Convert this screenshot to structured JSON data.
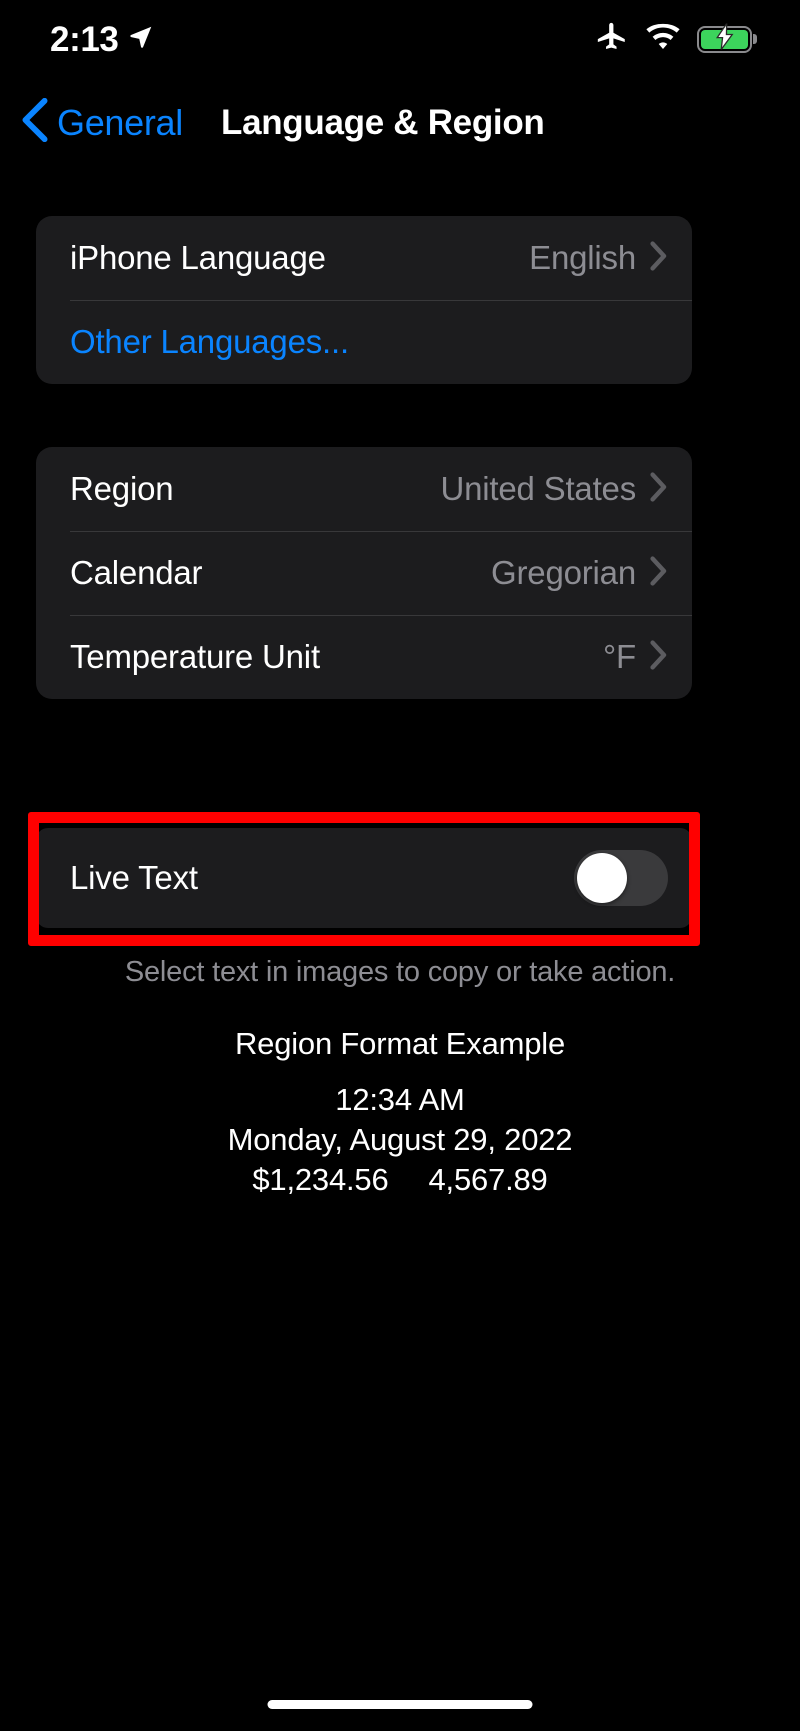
{
  "status_bar": {
    "time": "2:13",
    "location_icon": "location-arrow-icon",
    "airplane_icon": "airplane-mode-icon",
    "wifi_icon": "wifi-icon",
    "battery_icon": "battery-charging-icon",
    "battery_color": "#3cd45c"
  },
  "nav": {
    "back_label": "General",
    "back_icon": "chevron-left-icon",
    "title": "Language & Region",
    "accent_color": "#0a84ff"
  },
  "groups": [
    {
      "name": "language-group",
      "rows": [
        {
          "label": "iPhone Language",
          "value": "English",
          "type": "disclosure"
        },
        {
          "label": "Other Languages...",
          "value": "",
          "type": "link"
        }
      ]
    },
    {
      "name": "region-group",
      "rows": [
        {
          "label": "Region",
          "value": "United States",
          "type": "disclosure"
        },
        {
          "label": "Calendar",
          "value": "Gregorian",
          "type": "disclosure"
        },
        {
          "label": "Temperature Unit",
          "value": "°F",
          "type": "disclosure"
        }
      ]
    }
  ],
  "live_text": {
    "label": "Live Text",
    "toggle_state": "off",
    "toggle_track_color": "#3a3a3c",
    "footer": "Select text in images to copy or take action.",
    "highlight_color": "#ff0000"
  },
  "region_example": {
    "title": "Region Format Example",
    "time": "12:34 AM",
    "date": "Monday, August 29, 2022",
    "currency": "$1,234.56",
    "number": "4,567.89"
  },
  "home_indicator": "home-indicator"
}
